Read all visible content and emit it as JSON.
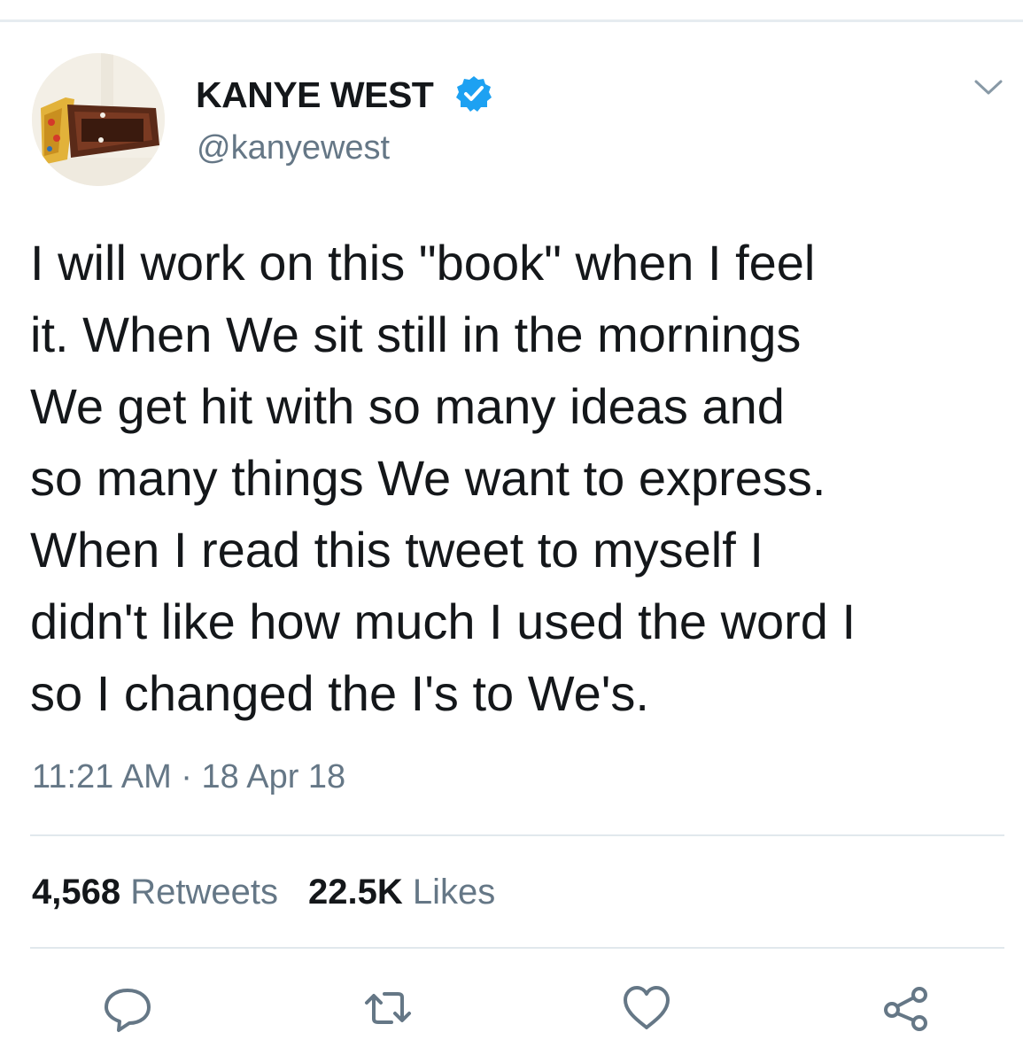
{
  "author": {
    "display_name": "KANYE WEST",
    "handle": "@kanyewest",
    "verified": true
  },
  "tweet": {
    "lines": [
      "I will work on this \"book\" when I feel",
      "it. When We sit still in the mornings",
      "We get hit with so many ideas and",
      "so many things We want to express.",
      "When I read this tweet to myself I",
      "didn't like how much I used the word I",
      "so I changed the I's to We's."
    ],
    "timestamp": "11:21 AM · 18 Apr 18"
  },
  "stats": {
    "retweets_count": "4,568",
    "retweets_label": "Retweets",
    "likes_count": "22.5K",
    "likes_label": "Likes"
  },
  "icons": {
    "verified": "verified-badge-icon",
    "caret": "chevron-down-icon",
    "reply": "reply-icon",
    "retweet": "retweet-icon",
    "like": "heart-icon",
    "share": "share-icon"
  },
  "colors": {
    "text": "#14171a",
    "secondary_text": "#657786",
    "verified_blue": "#1da1f2",
    "icon_gray": "#657786",
    "divider": "#e1e8ed"
  }
}
